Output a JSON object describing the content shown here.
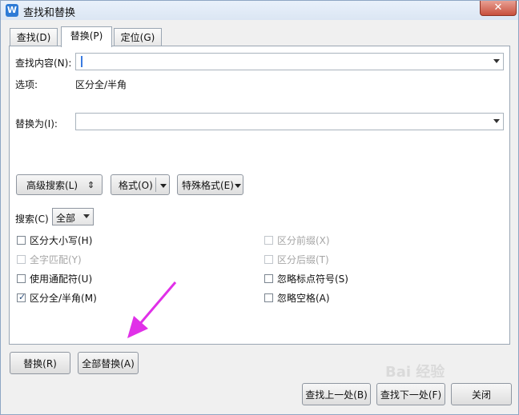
{
  "window": {
    "title": "查找和替换",
    "app_icon_letter": "W",
    "close_glyph": "✕"
  },
  "tabs": [
    {
      "label": "查找(D)"
    },
    {
      "label": "替换(P)"
    },
    {
      "label": "定位(G)"
    }
  ],
  "find": {
    "label": "查找内容(N):",
    "value": ""
  },
  "options": {
    "label": "选项:",
    "value": "区分全/半角"
  },
  "replace": {
    "label": "替换为(I):",
    "value": ""
  },
  "buttons": {
    "advanced": "高级搜索(L)",
    "advanced_glyph": "⇕",
    "format": "格式(O)",
    "special": "特殊格式(E)",
    "replace": "替换(R)",
    "replace_all": "全部替换(A)",
    "find_prev": "查找上一处(B)",
    "find_next": "查找下一处(F)",
    "close": "关闭"
  },
  "search": {
    "label": "搜索(C)",
    "value": "全部"
  },
  "checkboxes": {
    "match_case": {
      "label": "区分大小写(H)",
      "checked": false,
      "enabled": true
    },
    "whole_word": {
      "label": "全字匹配(Y)",
      "checked": false,
      "enabled": false
    },
    "wildcards": {
      "label": "使用通配符(U)",
      "checked": false,
      "enabled": true
    },
    "full_half": {
      "label": "区分全/半角(M)",
      "checked": true,
      "enabled": true
    },
    "prefix": {
      "label": "区分前缀(X)",
      "checked": false,
      "enabled": false
    },
    "suffix": {
      "label": "区分后缀(T)",
      "checked": false,
      "enabled": false
    },
    "ignore_punct": {
      "label": "忽略标点符号(S)",
      "checked": false,
      "enabled": true
    },
    "ignore_space": {
      "label": "忽略空格(A)",
      "checked": false,
      "enabled": true
    }
  },
  "accent_colors": {
    "annotation_arrow": "#e030e8",
    "title_logo": "#2e7bd6"
  },
  "watermark": {
    "text": "Bai 经验"
  }
}
